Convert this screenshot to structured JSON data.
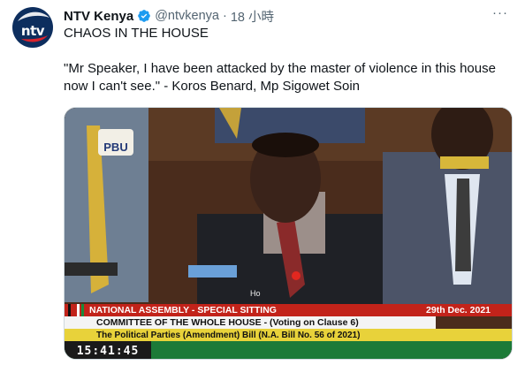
{
  "tweet": {
    "display_name": "NTV Kenya",
    "handle": "@ntvkenya",
    "separator": "·",
    "time": "18 小時",
    "more_label": "···",
    "text_line1": "CHAOS IN THE HOUSE",
    "text_line2": "\"Mr Speaker, I have been attacked by the master of violence in this house now I can't see.\" - Koros Benard, Mp Sigowet Soin"
  },
  "avatar": {
    "logo_text": "ntv"
  },
  "media": {
    "badge": "PBU",
    "overlay_caption": "Ho",
    "ticker": {
      "title": "NATIONAL ASSEMBLY - SPECIAL SITTING",
      "date": "29th Dec. 2021",
      "line2": "COMMITTEE OF THE WHOLE HOUSE - (Voting on Clause 6)",
      "line3": "The Political Parties (Amendment) Bill (N.A. Bill No. 56 of 2021)",
      "clock": "15:41:45"
    }
  },
  "colors": {
    "verified": "#1d9bf0",
    "ticker_red": "#c2231a",
    "ticker_green": "#1c7a38",
    "ticker_yellow": "#e8d23a"
  },
  "icons": {
    "verified": "verified-badge-icon",
    "more": "more-icon"
  }
}
